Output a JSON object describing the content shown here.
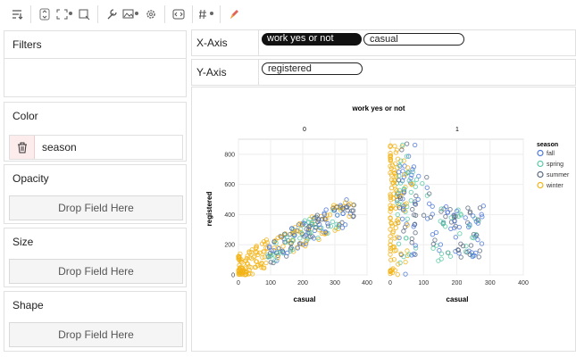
{
  "toolbar": {
    "icons": [
      "sort-icon",
      "chevron-updown-icon",
      "expand-icon",
      "brush-icon",
      "wrench-icon",
      "image-icon",
      "gear-icon",
      "code-icon",
      "hash-icon",
      "color-icon"
    ]
  },
  "filters": {
    "title": "Filters"
  },
  "color": {
    "title": "Color",
    "field": "season"
  },
  "opacity": {
    "title": "Opacity",
    "drop": "Drop Field Here"
  },
  "size": {
    "title": "Size",
    "drop": "Drop Field Here"
  },
  "shape": {
    "title": "Shape",
    "drop": "Drop Field Here"
  },
  "xaxis": {
    "label": "X-Axis",
    "fields": [
      "work yes or not",
      "casual"
    ]
  },
  "yaxis": {
    "label": "Y-Axis",
    "fields": [
      "registered"
    ]
  },
  "chart_data": {
    "type": "scatter",
    "title": "work yes or not",
    "facets": [
      "0",
      "1"
    ],
    "xlabel": "casual",
    "ylabel": "registered",
    "xlim": [
      0,
      400
    ],
    "ylim": [
      0,
      900
    ],
    "xticks": [
      "0",
      "100",
      "200",
      "300",
      "400"
    ],
    "yticks": [
      "0",
      "200",
      "400",
      "600",
      "800"
    ],
    "legend": {
      "title": "season",
      "position": "right"
    },
    "series": [
      {
        "name": "fall",
        "color": "#4c78d8"
      },
      {
        "name": "spring",
        "color": "#59c9a5"
      },
      {
        "name": "summer",
        "color": "#5a6a80"
      },
      {
        "name": "winter",
        "color": "#f2b418"
      }
    ]
  }
}
